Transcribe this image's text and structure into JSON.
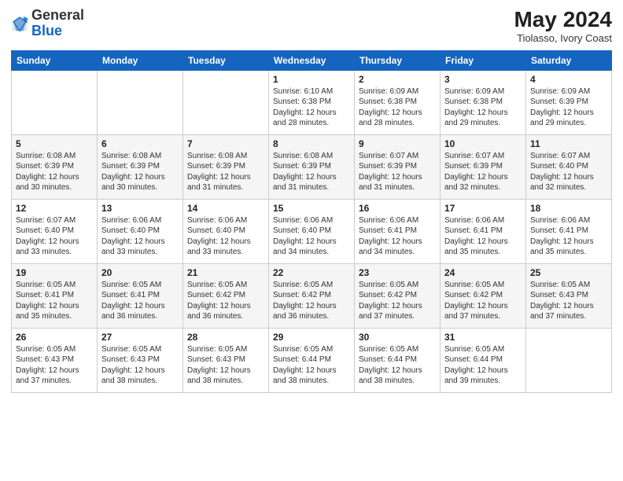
{
  "header": {
    "logo_general": "General",
    "logo_blue": "Blue",
    "month_title": "May 2024",
    "location": "Tiolasso, Ivory Coast"
  },
  "weekdays": [
    "Sunday",
    "Monday",
    "Tuesday",
    "Wednesday",
    "Thursday",
    "Friday",
    "Saturday"
  ],
  "weeks": [
    [
      {
        "day": "",
        "sunrise": "",
        "sunset": "",
        "daylight": ""
      },
      {
        "day": "",
        "sunrise": "",
        "sunset": "",
        "daylight": ""
      },
      {
        "day": "",
        "sunrise": "",
        "sunset": "",
        "daylight": ""
      },
      {
        "day": "1",
        "sunrise": "Sunrise: 6:10 AM",
        "sunset": "Sunset: 6:38 PM",
        "daylight": "Daylight: 12 hours and 28 minutes."
      },
      {
        "day": "2",
        "sunrise": "Sunrise: 6:09 AM",
        "sunset": "Sunset: 6:38 PM",
        "daylight": "Daylight: 12 hours and 28 minutes."
      },
      {
        "day": "3",
        "sunrise": "Sunrise: 6:09 AM",
        "sunset": "Sunset: 6:38 PM",
        "daylight": "Daylight: 12 hours and 29 minutes."
      },
      {
        "day": "4",
        "sunrise": "Sunrise: 6:09 AM",
        "sunset": "Sunset: 6:39 PM",
        "daylight": "Daylight: 12 hours and 29 minutes."
      }
    ],
    [
      {
        "day": "5",
        "sunrise": "Sunrise: 6:08 AM",
        "sunset": "Sunset: 6:39 PM",
        "daylight": "Daylight: 12 hours and 30 minutes."
      },
      {
        "day": "6",
        "sunrise": "Sunrise: 6:08 AM",
        "sunset": "Sunset: 6:39 PM",
        "daylight": "Daylight: 12 hours and 30 minutes."
      },
      {
        "day": "7",
        "sunrise": "Sunrise: 6:08 AM",
        "sunset": "Sunset: 6:39 PM",
        "daylight": "Daylight: 12 hours and 31 minutes."
      },
      {
        "day": "8",
        "sunrise": "Sunrise: 6:08 AM",
        "sunset": "Sunset: 6:39 PM",
        "daylight": "Daylight: 12 hours and 31 minutes."
      },
      {
        "day": "9",
        "sunrise": "Sunrise: 6:07 AM",
        "sunset": "Sunset: 6:39 PM",
        "daylight": "Daylight: 12 hours and 31 minutes."
      },
      {
        "day": "10",
        "sunrise": "Sunrise: 6:07 AM",
        "sunset": "Sunset: 6:39 PM",
        "daylight": "Daylight: 12 hours and 32 minutes."
      },
      {
        "day": "11",
        "sunrise": "Sunrise: 6:07 AM",
        "sunset": "Sunset: 6:40 PM",
        "daylight": "Daylight: 12 hours and 32 minutes."
      }
    ],
    [
      {
        "day": "12",
        "sunrise": "Sunrise: 6:07 AM",
        "sunset": "Sunset: 6:40 PM",
        "daylight": "Daylight: 12 hours and 33 minutes."
      },
      {
        "day": "13",
        "sunrise": "Sunrise: 6:06 AM",
        "sunset": "Sunset: 6:40 PM",
        "daylight": "Daylight: 12 hours and 33 minutes."
      },
      {
        "day": "14",
        "sunrise": "Sunrise: 6:06 AM",
        "sunset": "Sunset: 6:40 PM",
        "daylight": "Daylight: 12 hours and 33 minutes."
      },
      {
        "day": "15",
        "sunrise": "Sunrise: 6:06 AM",
        "sunset": "Sunset: 6:40 PM",
        "daylight": "Daylight: 12 hours and 34 minutes."
      },
      {
        "day": "16",
        "sunrise": "Sunrise: 6:06 AM",
        "sunset": "Sunset: 6:41 PM",
        "daylight": "Daylight: 12 hours and 34 minutes."
      },
      {
        "day": "17",
        "sunrise": "Sunrise: 6:06 AM",
        "sunset": "Sunset: 6:41 PM",
        "daylight": "Daylight: 12 hours and 35 minutes."
      },
      {
        "day": "18",
        "sunrise": "Sunrise: 6:06 AM",
        "sunset": "Sunset: 6:41 PM",
        "daylight": "Daylight: 12 hours and 35 minutes."
      }
    ],
    [
      {
        "day": "19",
        "sunrise": "Sunrise: 6:05 AM",
        "sunset": "Sunset: 6:41 PM",
        "daylight": "Daylight: 12 hours and 35 minutes."
      },
      {
        "day": "20",
        "sunrise": "Sunrise: 6:05 AM",
        "sunset": "Sunset: 6:41 PM",
        "daylight": "Daylight: 12 hours and 36 minutes."
      },
      {
        "day": "21",
        "sunrise": "Sunrise: 6:05 AM",
        "sunset": "Sunset: 6:42 PM",
        "daylight": "Daylight: 12 hours and 36 minutes."
      },
      {
        "day": "22",
        "sunrise": "Sunrise: 6:05 AM",
        "sunset": "Sunset: 6:42 PM",
        "daylight": "Daylight: 12 hours and 36 minutes."
      },
      {
        "day": "23",
        "sunrise": "Sunrise: 6:05 AM",
        "sunset": "Sunset: 6:42 PM",
        "daylight": "Daylight: 12 hours and 37 minutes."
      },
      {
        "day": "24",
        "sunrise": "Sunrise: 6:05 AM",
        "sunset": "Sunset: 6:42 PM",
        "daylight": "Daylight: 12 hours and 37 minutes."
      },
      {
        "day": "25",
        "sunrise": "Sunrise: 6:05 AM",
        "sunset": "Sunset: 6:43 PM",
        "daylight": "Daylight: 12 hours and 37 minutes."
      }
    ],
    [
      {
        "day": "26",
        "sunrise": "Sunrise: 6:05 AM",
        "sunset": "Sunset: 6:43 PM",
        "daylight": "Daylight: 12 hours and 37 minutes."
      },
      {
        "day": "27",
        "sunrise": "Sunrise: 6:05 AM",
        "sunset": "Sunset: 6:43 PM",
        "daylight": "Daylight: 12 hours and 38 minutes."
      },
      {
        "day": "28",
        "sunrise": "Sunrise: 6:05 AM",
        "sunset": "Sunset: 6:43 PM",
        "daylight": "Daylight: 12 hours and 38 minutes."
      },
      {
        "day": "29",
        "sunrise": "Sunrise: 6:05 AM",
        "sunset": "Sunset: 6:44 PM",
        "daylight": "Daylight: 12 hours and 38 minutes."
      },
      {
        "day": "30",
        "sunrise": "Sunrise: 6:05 AM",
        "sunset": "Sunset: 6:44 PM",
        "daylight": "Daylight: 12 hours and 38 minutes."
      },
      {
        "day": "31",
        "sunrise": "Sunrise: 6:05 AM",
        "sunset": "Sunset: 6:44 PM",
        "daylight": "Daylight: 12 hours and 39 minutes."
      },
      {
        "day": "",
        "sunrise": "",
        "sunset": "",
        "daylight": ""
      }
    ]
  ]
}
